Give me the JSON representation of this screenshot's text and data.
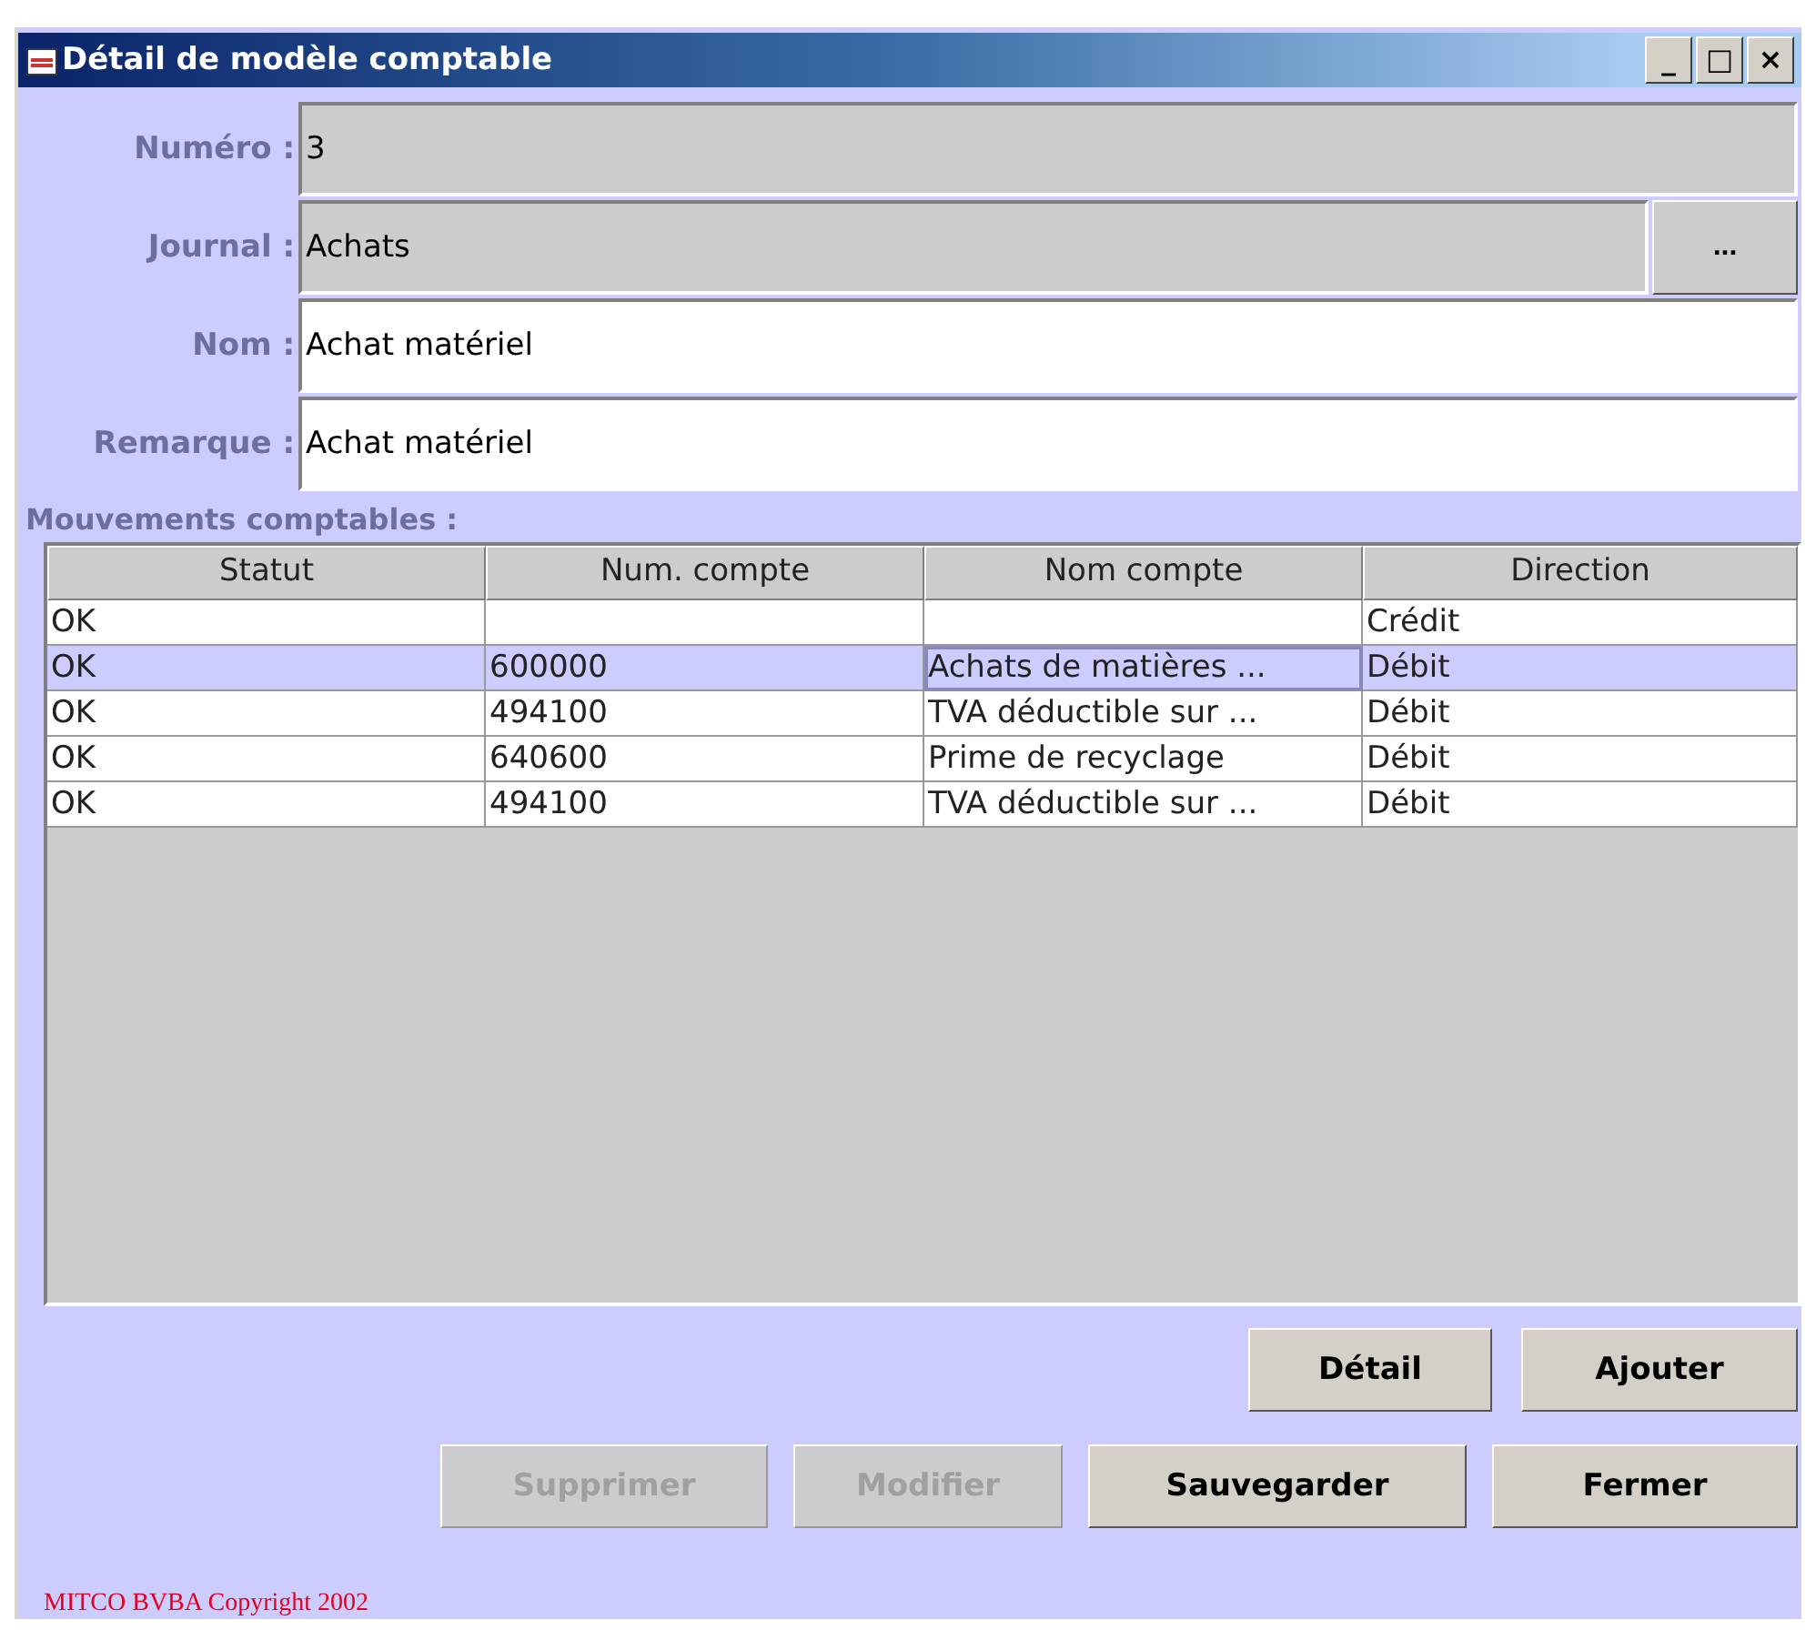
{
  "window": {
    "title": "Détail de modèle comptable",
    "controls": [
      "_",
      "□",
      "×"
    ]
  },
  "fields": [
    {
      "label": "Numéro :",
      "value": "3",
      "editable": false
    },
    {
      "label": "Journal :",
      "value": "Achats",
      "editable": false,
      "button": "..."
    },
    {
      "label": "Nom :",
      "value": "Achat matériel",
      "editable": true
    },
    {
      "label": "Remarque :",
      "value": "Achat matériel",
      "editable": true
    }
  ],
  "table": {
    "title": "Mouvements comptables :",
    "columns": [
      "Statut",
      "Num. compte",
      "Nom compte",
      "Direction"
    ],
    "rows": [
      {
        "cells": [
          "OK",
          "",
          "",
          "Crédit"
        ],
        "selected": false
      },
      {
        "cells": [
          "OK",
          "600000",
          "Achats de matières ...",
          "Débit"
        ],
        "selected": true
      },
      {
        "cells": [
          "OK",
          "494100",
          "TVA déductible sur ...",
          "Débit"
        ],
        "selected": false
      },
      {
        "cells": [
          "OK",
          "640600",
          "Prime de recyclage",
          "Débit"
        ],
        "selected": false
      },
      {
        "cells": [
          "OK",
          "494100",
          "TVA déductible sur ...",
          "Débit"
        ],
        "selected": false
      }
    ]
  },
  "buttons_top": [
    {
      "label": "Détail",
      "disabled": false
    },
    {
      "label": "Ajouter",
      "disabled": false
    }
  ],
  "buttons_bottom": [
    {
      "label": "Supprimer",
      "disabled": true
    },
    {
      "label": "Modifier",
      "disabled": true
    },
    {
      "label": "Sauvegarder",
      "disabled": false
    },
    {
      "label": "Fermer",
      "disabled": false
    }
  ],
  "copyright": "MITCO BVBA Copyright 2002"
}
